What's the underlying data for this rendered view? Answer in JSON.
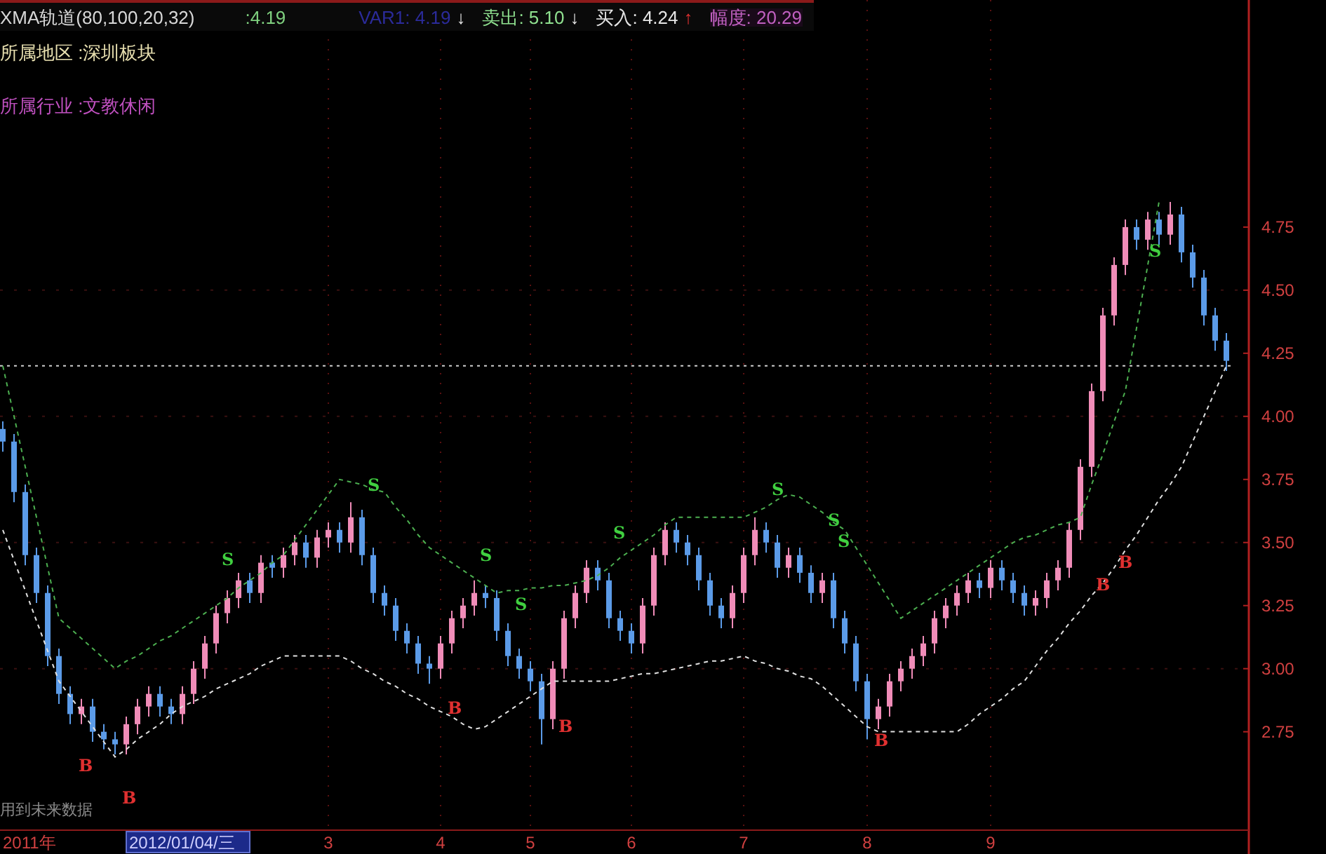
{
  "indicator": {
    "name": "XMA轨道(80,100,20,32)",
    "value": ":4.19",
    "readings": [
      {
        "kind": "var",
        "text": "VAR1: 4.19",
        "arrow": "↓"
      },
      {
        "kind": "sell",
        "text": "卖出: 5.10",
        "arrow": "↓"
      },
      {
        "kind": "buy",
        "text": "买入: 4.24",
        "arrow": "↑"
      },
      {
        "kind": "range",
        "text": "幅度: 20.29"
      }
    ]
  },
  "info_lines": [
    {
      "kind": "region",
      "text": "所属地区 :深圳板块"
    },
    {
      "kind": "industry",
      "text": "所属行业 :文教休闲"
    }
  ],
  "notice": "用到未来数据",
  "year_label": "2011年",
  "cursor_date": "2012/01/04/三",
  "signals": [
    {
      "kind": "sell",
      "label": "S"
    },
    {
      "kind": "sell",
      "label": "S"
    },
    {
      "kind": "sell",
      "label": "S"
    },
    {
      "kind": "sell",
      "label": "S"
    },
    {
      "kind": "sell",
      "label": "S"
    },
    {
      "kind": "sell",
      "label": "S"
    },
    {
      "kind": "sell",
      "label": "S"
    },
    {
      "kind": "sell",
      "label": "S"
    },
    {
      "kind": "sell",
      "label": "S"
    },
    {
      "kind": "buy",
      "label": "B"
    },
    {
      "kind": "buy",
      "label": "B"
    },
    {
      "kind": "buy",
      "label": "B"
    },
    {
      "kind": "buy",
      "label": "B"
    },
    {
      "kind": "buy",
      "label": "B"
    },
    {
      "kind": "buy",
      "label": "B"
    },
    {
      "kind": "buy",
      "label": "B"
    }
  ],
  "chart_data": {
    "type": "candlestick",
    "grid": true,
    "ylim": [
      2.36,
      5.65
    ],
    "categories": [
      null,
      null,
      null,
      null,
      null,
      null,
      null,
      null,
      null,
      null,
      null,
      null,
      null,
      null,
      null,
      null,
      null,
      null,
      null,
      null,
      null,
      null,
      null,
      null,
      null,
      null,
      null,
      null,
      null,
      "3",
      null,
      null,
      null,
      null,
      null,
      null,
      null,
      null,
      null,
      "4",
      null,
      null,
      null,
      null,
      null,
      null,
      null,
      "5",
      null,
      null,
      null,
      null,
      null,
      null,
      null,
      null,
      "6",
      null,
      null,
      null,
      null,
      null,
      null,
      null,
      null,
      null,
      "7",
      null,
      null,
      null,
      null,
      null,
      null,
      null,
      null,
      null,
      null,
      "8",
      null,
      null,
      null,
      null,
      null,
      null,
      null,
      null,
      null,
      null,
      "9",
      null,
      null,
      null,
      null,
      null,
      null,
      null,
      null,
      null,
      null,
      null,
      null,
      null,
      null,
      null,
      null,
      null,
      null,
      null,
      null,
      null
    ],
    "yticks": [
      {
        "value": 4.75,
        "label": "4.75"
      },
      {
        "value": 4.5,
        "label": "4.50"
      },
      {
        "value": 4.25,
        "label": "4.25"
      },
      {
        "value": 4.0,
        "label": "4.00"
      },
      {
        "value": 3.75,
        "label": "3.75"
      },
      {
        "value": 3.5,
        "label": "3.50"
      },
      {
        "value": 3.25,
        "label": "3.25"
      },
      {
        "value": 3.0,
        "label": "3.00"
      },
      {
        "value": 2.75,
        "label": "2.75"
      }
    ],
    "ohlc": [
      [
        3.95,
        3.98,
        3.86,
        3.9
      ],
      [
        3.9,
        3.93,
        3.66,
        3.7
      ],
      [
        3.7,
        3.73,
        3.41,
        3.45
      ],
      [
        3.45,
        3.48,
        3.26,
        3.3
      ],
      [
        3.3,
        3.33,
        3.01,
        3.05
      ],
      [
        3.05,
        3.08,
        2.86,
        2.9
      ],
      [
        2.9,
        2.93,
        2.78,
        2.82
      ],
      [
        2.82,
        2.88,
        2.78,
        2.85
      ],
      [
        2.85,
        2.88,
        2.71,
        2.75
      ],
      [
        2.75,
        2.78,
        2.68,
        2.72
      ],
      [
        2.72,
        2.75,
        2.66,
        2.7
      ],
      [
        2.7,
        2.81,
        2.66,
        2.78
      ],
      [
        2.78,
        2.88,
        2.74,
        2.85
      ],
      [
        2.85,
        2.93,
        2.81,
        2.9
      ],
      [
        2.9,
        2.93,
        2.81,
        2.85
      ],
      [
        2.85,
        2.88,
        2.78,
        2.82
      ],
      [
        2.82,
        2.93,
        2.78,
        2.9
      ],
      [
        2.9,
        3.03,
        2.86,
        3.0
      ],
      [
        3.0,
        3.13,
        2.96,
        3.1
      ],
      [
        3.1,
        3.25,
        3.06,
        3.22
      ],
      [
        3.22,
        3.31,
        3.18,
        3.28
      ],
      [
        3.28,
        3.38,
        3.24,
        3.35
      ],
      [
        3.35,
        3.38,
        3.26,
        3.3
      ],
      [
        3.3,
        3.45,
        3.26,
        3.42
      ],
      [
        3.42,
        3.45,
        3.36,
        3.4
      ],
      [
        3.4,
        3.48,
        3.36,
        3.45
      ],
      [
        3.45,
        3.53,
        3.41,
        3.5
      ],
      [
        3.5,
        3.53,
        3.4,
        3.44
      ],
      [
        3.44,
        3.55,
        3.4,
        3.52
      ],
      [
        3.52,
        3.58,
        3.48,
        3.55
      ],
      [
        3.55,
        3.58,
        3.46,
        3.5
      ],
      [
        3.5,
        3.66,
        3.46,
        3.6
      ],
      [
        3.6,
        3.63,
        3.41,
        3.45
      ],
      [
        3.45,
        3.48,
        3.26,
        3.3
      ],
      [
        3.3,
        3.33,
        3.21,
        3.25
      ],
      [
        3.25,
        3.28,
        3.11,
        3.15
      ],
      [
        3.15,
        3.18,
        3.06,
        3.1
      ],
      [
        3.1,
        3.13,
        2.98,
        3.02
      ],
      [
        3.02,
        3.05,
        2.94,
        3.0
      ],
      [
        3.0,
        3.13,
        2.96,
        3.1
      ],
      [
        3.1,
        3.23,
        3.06,
        3.2
      ],
      [
        3.2,
        3.28,
        3.16,
        3.25
      ],
      [
        3.25,
        3.35,
        3.21,
        3.3
      ],
      [
        3.3,
        3.33,
        3.24,
        3.28
      ],
      [
        3.28,
        3.31,
        3.11,
        3.15
      ],
      [
        3.15,
        3.18,
        3.01,
        3.05
      ],
      [
        3.05,
        3.08,
        2.96,
        3.0
      ],
      [
        3.0,
        3.03,
        2.91,
        2.95
      ],
      [
        2.95,
        2.98,
        2.7,
        2.8
      ],
      [
        2.8,
        3.03,
        2.76,
        3.0
      ],
      [
        3.0,
        3.23,
        2.96,
        3.2
      ],
      [
        3.2,
        3.33,
        3.16,
        3.3
      ],
      [
        3.3,
        3.43,
        3.26,
        3.4
      ],
      [
        3.4,
        3.43,
        3.31,
        3.35
      ],
      [
        3.35,
        3.38,
        3.16,
        3.2
      ],
      [
        3.2,
        3.23,
        3.11,
        3.15
      ],
      [
        3.15,
        3.18,
        3.06,
        3.1
      ],
      [
        3.1,
        3.28,
        3.06,
        3.25
      ],
      [
        3.25,
        3.48,
        3.21,
        3.45
      ],
      [
        3.45,
        3.58,
        3.41,
        3.55
      ],
      [
        3.55,
        3.58,
        3.46,
        3.5
      ],
      [
        3.5,
        3.53,
        3.41,
        3.45
      ],
      [
        3.45,
        3.48,
        3.31,
        3.35
      ],
      [
        3.35,
        3.38,
        3.21,
        3.25
      ],
      [
        3.25,
        3.28,
        3.16,
        3.2
      ],
      [
        3.2,
        3.33,
        3.16,
        3.3
      ],
      [
        3.3,
        3.48,
        3.26,
        3.45
      ],
      [
        3.45,
        3.6,
        3.41,
        3.55
      ],
      [
        3.55,
        3.58,
        3.46,
        3.5
      ],
      [
        3.5,
        3.53,
        3.36,
        3.4
      ],
      [
        3.4,
        3.48,
        3.36,
        3.45
      ],
      [
        3.45,
        3.48,
        3.34,
        3.38
      ],
      [
        3.38,
        3.41,
        3.26,
        3.3
      ],
      [
        3.3,
        3.38,
        3.26,
        3.35
      ],
      [
        3.35,
        3.38,
        3.16,
        3.2
      ],
      [
        3.2,
        3.23,
        3.06,
        3.1
      ],
      [
        3.1,
        3.13,
        2.91,
        2.95
      ],
      [
        2.95,
        2.98,
        2.72,
        2.8
      ],
      [
        2.8,
        2.88,
        2.76,
        2.85
      ],
      [
        2.85,
        2.98,
        2.81,
        2.95
      ],
      [
        2.95,
        3.03,
        2.91,
        3.0
      ],
      [
        3.0,
        3.08,
        2.96,
        3.05
      ],
      [
        3.05,
        3.13,
        3.01,
        3.1
      ],
      [
        3.1,
        3.23,
        3.06,
        3.2
      ],
      [
        3.2,
        3.28,
        3.16,
        3.25
      ],
      [
        3.25,
        3.33,
        3.21,
        3.3
      ],
      [
        3.3,
        3.38,
        3.26,
        3.35
      ],
      [
        3.35,
        3.38,
        3.28,
        3.32
      ],
      [
        3.32,
        3.43,
        3.28,
        3.4
      ],
      [
        3.4,
        3.43,
        3.31,
        3.35
      ],
      [
        3.35,
        3.38,
        3.26,
        3.3
      ],
      [
        3.3,
        3.33,
        3.21,
        3.25
      ],
      [
        3.25,
        3.31,
        3.21,
        3.28
      ],
      [
        3.28,
        3.38,
        3.24,
        3.35
      ],
      [
        3.35,
        3.43,
        3.31,
        3.4
      ],
      [
        3.4,
        3.58,
        3.36,
        3.55
      ],
      [
        3.55,
        3.83,
        3.51,
        3.8
      ],
      [
        3.8,
        4.13,
        3.76,
        4.1
      ],
      [
        4.1,
        4.43,
        4.06,
        4.4
      ],
      [
        4.4,
        4.63,
        4.36,
        4.6
      ],
      [
        4.6,
        4.78,
        4.56,
        4.75
      ],
      [
        4.75,
        4.78,
        4.66,
        4.7
      ],
      [
        4.7,
        4.81,
        4.66,
        4.78
      ],
      [
        4.78,
        4.81,
        4.68,
        4.72
      ],
      [
        4.72,
        4.85,
        4.68,
        4.8
      ],
      [
        4.8,
        4.83,
        4.61,
        4.65
      ],
      [
        4.65,
        4.68,
        4.51,
        4.55
      ],
      [
        4.55,
        4.58,
        4.36,
        4.4
      ],
      [
        4.4,
        4.43,
        4.26,
        4.3
      ],
      [
        4.3,
        4.33,
        4.18,
        4.22
      ]
    ],
    "series": [
      {
        "type": "line",
        "color": "#4caf50",
        "line_style": "dashed",
        "values": [
          4.2,
          4.0,
          3.8,
          3.6,
          3.4,
          3.2,
          3.16,
          3.12,
          3.08,
          3.04,
          3.0,
          3.03,
          3.05,
          3.08,
          3.11,
          3.13,
          3.16,
          3.19,
          3.22,
          3.25,
          3.28,
          3.32,
          3.35,
          3.38,
          3.42,
          3.45,
          3.51,
          3.57,
          3.63,
          3.69,
          3.75,
          3.74,
          3.73,
          3.71,
          3.7,
          3.64,
          3.59,
          3.53,
          3.48,
          3.45,
          3.42,
          3.39,
          3.36,
          3.33,
          3.3,
          3.31,
          3.31,
          3.32,
          3.32,
          3.33,
          3.33,
          3.34,
          3.35,
          3.37,
          3.4,
          3.44,
          3.47,
          3.5,
          3.53,
          3.57,
          3.6,
          3.6,
          3.6,
          3.6,
          3.6,
          3.6,
          3.6,
          3.62,
          3.64,
          3.67,
          3.69,
          3.68,
          3.65,
          3.62,
          3.58,
          3.55,
          3.48,
          3.41,
          3.34,
          3.27,
          3.2,
          3.23,
          3.26,
          3.29,
          3.32,
          3.35,
          3.38,
          3.41,
          3.44,
          3.47,
          3.5,
          3.52,
          3.53,
          3.55,
          3.57,
          3.58,
          3.6,
          3.73,
          3.85,
          3.98,
          4.1,
          4.35,
          4.6,
          4.85,
          null,
          null,
          null,
          null,
          null,
          null
        ]
      },
      {
        "type": "line",
        "color": "#e0e0e0",
        "line_style": "dashed",
        "values": [
          3.55,
          3.43,
          3.31,
          3.19,
          3.07,
          2.95,
          2.89,
          2.83,
          2.77,
          2.71,
          2.65,
          2.68,
          2.72,
          2.75,
          2.78,
          2.82,
          2.85,
          2.87,
          2.89,
          2.92,
          2.94,
          2.96,
          2.98,
          3.01,
          3.03,
          3.05,
          3.05,
          3.05,
          3.05,
          3.05,
          3.05,
          3.03,
          3.0,
          2.98,
          2.95,
          2.93,
          2.9,
          2.88,
          2.85,
          2.83,
          2.81,
          2.78,
          2.76,
          2.77,
          2.8,
          2.83,
          2.86,
          2.89,
          2.92,
          2.95,
          2.95,
          2.95,
          2.95,
          2.95,
          2.95,
          2.96,
          2.97,
          2.98,
          2.98,
          2.99,
          3.0,
          3.01,
          3.02,
          3.03,
          3.03,
          3.04,
          3.05,
          3.03,
          3.02,
          3.0,
          2.99,
          2.97,
          2.96,
          2.93,
          2.89,
          2.85,
          2.81,
          2.77,
          2.75,
          2.75,
          2.75,
          2.75,
          2.75,
          2.75,
          2.75,
          2.75,
          2.78,
          2.82,
          2.85,
          2.88,
          2.92,
          2.95,
          3.01,
          3.07,
          3.12,
          3.18,
          3.23,
          3.29,
          3.34,
          3.4,
          3.47,
          3.53,
          3.6,
          3.67,
          3.73,
          3.8,
          3.9,
          4.0,
          4.1,
          4.2
        ]
      }
    ],
    "ref_lines": [
      {
        "axis": "y",
        "value": 4.2,
        "line_style": "dotted"
      }
    ]
  }
}
